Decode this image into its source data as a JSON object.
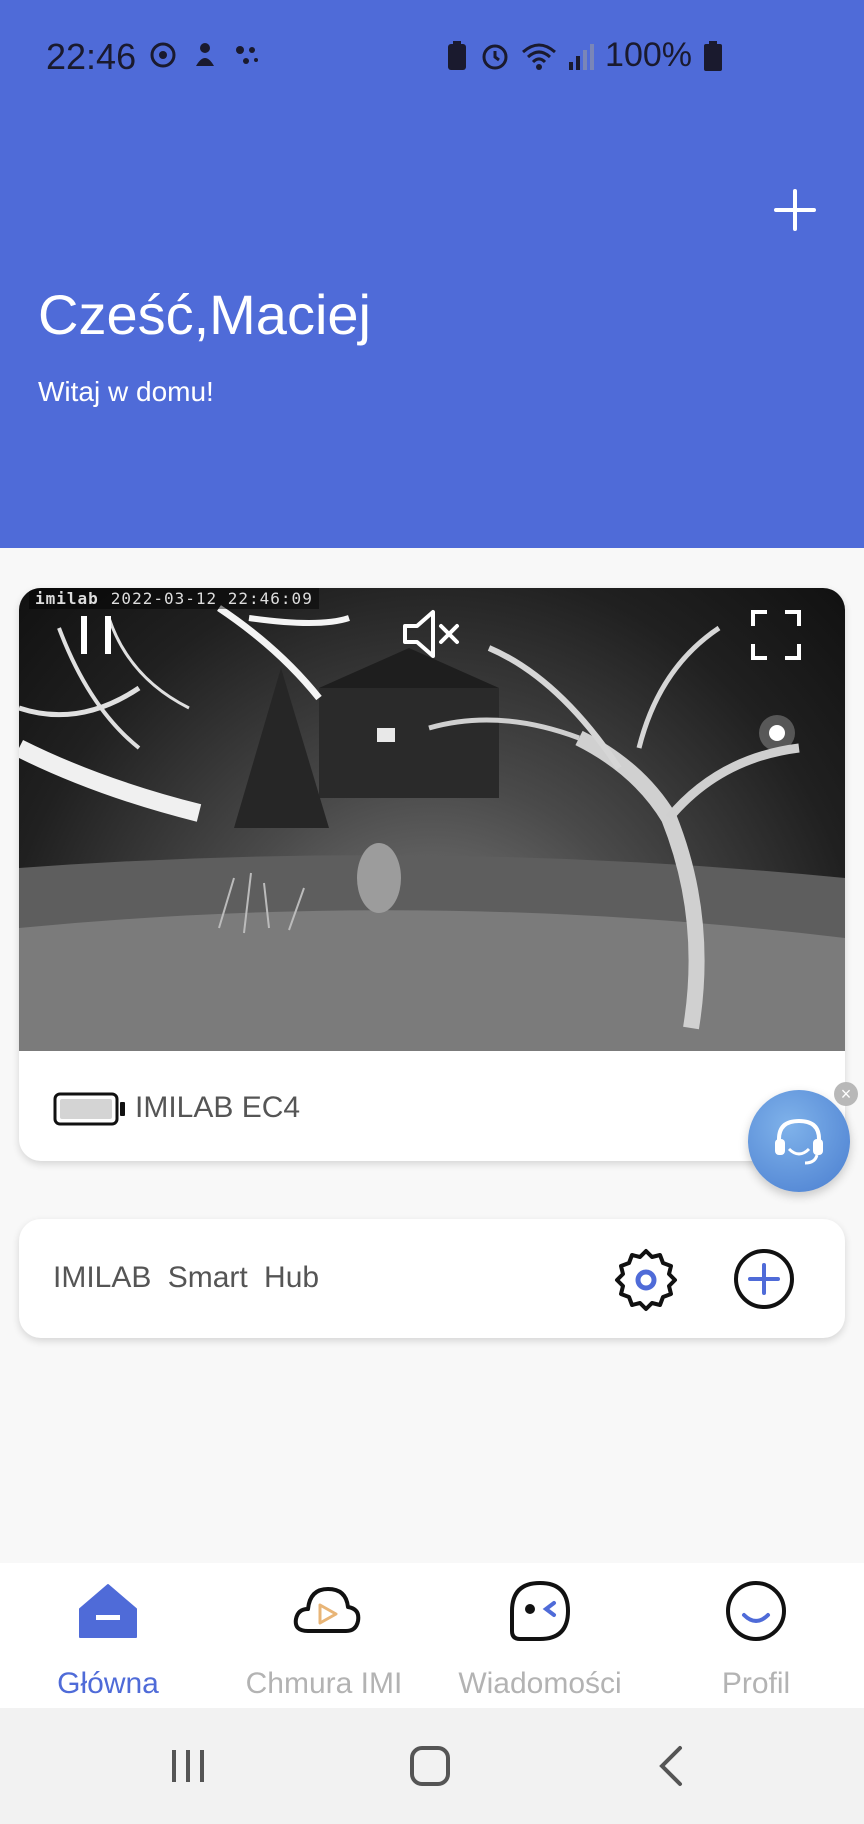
{
  "status_bar": {
    "time": "22:46",
    "battery_text": "100%"
  },
  "header": {
    "greeting": "Cześć,Maciej",
    "subtitle": "Witaj w domu!",
    "add_icon": "plus-icon"
  },
  "camera": {
    "watermark_brand": "imilab",
    "timestamp": "2022-03-12 22:46:09",
    "name": "IMILAB EC4",
    "controls": [
      "pause-icon",
      "mute-icon",
      "fullscreen-icon"
    ],
    "battery_icon": "battery-icon"
  },
  "support": {
    "icon": "headset-icon",
    "close_glyph": "×"
  },
  "hub": {
    "name": "IMILAB Smart Hub",
    "settings_icon": "gear-icon",
    "add_icon": "plus-circle-icon"
  },
  "bottom_nav": {
    "items": [
      {
        "label": "Główna",
        "icon": "home-icon",
        "active": true
      },
      {
        "label": "Chmura IMI",
        "icon": "cloud-play-icon",
        "active": false
      },
      {
        "label": "Wiadomości",
        "icon": "message-icon",
        "active": false
      },
      {
        "label": "Profil",
        "icon": "smile-icon",
        "active": false
      }
    ]
  },
  "colors": {
    "accent": "#4f6bd8",
    "header_bg": "#4f6bd8",
    "inactive_label": "#b3b3b3"
  }
}
